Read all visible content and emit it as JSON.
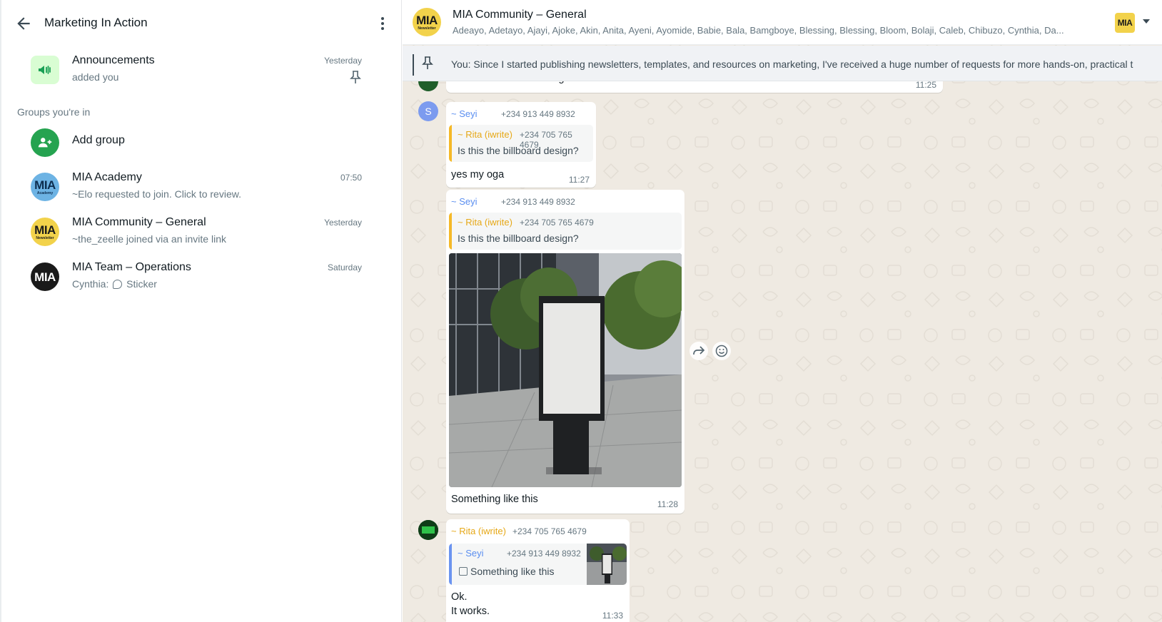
{
  "left": {
    "title": "Marketing In Action",
    "announcements": {
      "name": "Announcements",
      "sub": "added you",
      "time": "Yesterday"
    },
    "section_label": "Groups you're in",
    "add_group": "Add group",
    "groups": [
      {
        "name": "MIA Academy",
        "sub": "~Elo requested to join. Click to review.",
        "time": "07:50",
        "logo_big": "MIA",
        "logo_small": "Academy"
      },
      {
        "name": "MIA Community – General",
        "sub": "~the_zeelle joined via an invite link",
        "time": "Yesterday",
        "logo_big": "MIA",
        "logo_small": "Newsletter"
      },
      {
        "name": "MIA Team – Operations",
        "sub_prefix": "Cynthia:",
        "sub": "Sticker",
        "time": "Saturday",
        "logo_big": "MIA",
        "logo_small": ""
      }
    ]
  },
  "chat": {
    "title": "MIA Community – General",
    "logo_big": "MIA",
    "logo_small": "Newsletter",
    "members": "Adeayo, Adetayo, Ajayi, Ajoke, Akin, Anita, Ayeni, Ayomide, Babie, Bala, Bamgboye, Blessing, Blessing, Bloom, Bolaji, Caleb, Chibuzo, Cynthia, Da...",
    "pinned": "You: Since I started publishing newsletters, templates, and resources on marketing, I've received a huge number of requests for more hands-on, practical t",
    "messages": [
      {
        "text": "Is this the billboard design?",
        "time": "11:25"
      },
      {
        "avatar_letter": "S",
        "sender": "~ Seyi",
        "phone": "+234 913 449 8932",
        "quote_sender": "~ Rita (iwrite)",
        "quote_phone": "+234 705 765 4679",
        "quote_text": "Is this the billboard design?",
        "text": "yes my oga",
        "time": "11:27"
      },
      {
        "sender": "~ Seyi",
        "phone": "+234 913 449 8932",
        "quote_sender": "~ Rita (iwrite)",
        "quote_phone": "+234 705 765 4679",
        "quote_text": "Is this the billboard design?",
        "text": "Something like this",
        "time": "11:28"
      },
      {
        "sender": "~ Rita (iwrite)",
        "phone": "+234 705 765 4679",
        "quote_sender": "~ Seyi",
        "quote_phone": "+234 913 449 8932",
        "quote_text": "Something like this",
        "text_line1": "Ok.",
        "text_line2": "It works.",
        "time": "11:33"
      }
    ]
  },
  "colors": {
    "accent_green": "#25a350",
    "sender_blue": "#5a8ef0",
    "sender_orange": "#e6a817",
    "chat_bg": "#efeae2"
  }
}
